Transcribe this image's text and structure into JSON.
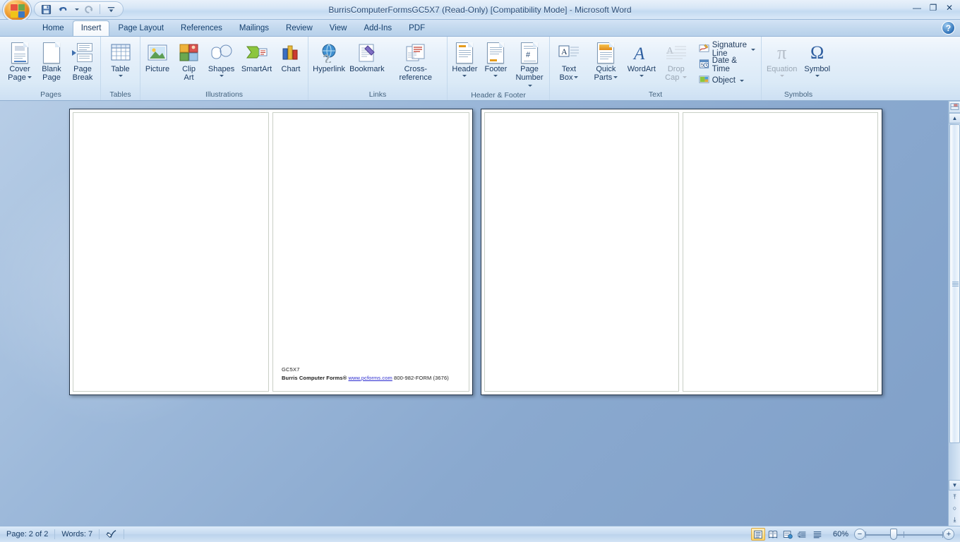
{
  "window": {
    "title": "BurrisComputerFormsGC5X7 (Read-Only) [Compatibility Mode] - Microsoft Word",
    "minimize": "—",
    "maximize": "❐",
    "close": "✕"
  },
  "quick_access": {
    "save": "save-icon",
    "undo": "undo-icon",
    "redo": "redo-icon",
    "customize": "customize-icon"
  },
  "tabs": [
    {
      "label": "Home",
      "active": false
    },
    {
      "label": "Insert",
      "active": true
    },
    {
      "label": "Page Layout",
      "active": false
    },
    {
      "label": "References",
      "active": false
    },
    {
      "label": "Mailings",
      "active": false
    },
    {
      "label": "Review",
      "active": false
    },
    {
      "label": "View",
      "active": false
    },
    {
      "label": "Add-Ins",
      "active": false
    },
    {
      "label": "PDF",
      "active": false
    }
  ],
  "help_button": "?",
  "ribbon": {
    "groups": [
      {
        "name": "Pages",
        "label": "Pages",
        "buttons": [
          {
            "label": "Cover Page",
            "dropdown": true,
            "disabled": false
          },
          {
            "label": "Blank Page",
            "dropdown": false,
            "disabled": false
          },
          {
            "label": "Page Break",
            "dropdown": false,
            "disabled": false
          }
        ]
      },
      {
        "name": "Tables",
        "label": "Tables",
        "buttons": [
          {
            "label": "Table",
            "dropdown": true,
            "disabled": false
          }
        ]
      },
      {
        "name": "Illustrations",
        "label": "Illustrations",
        "buttons": [
          {
            "label": "Picture",
            "dropdown": false,
            "disabled": false
          },
          {
            "label": "Clip Art",
            "dropdown": false,
            "disabled": false
          },
          {
            "label": "Shapes",
            "dropdown": true,
            "disabled": false
          },
          {
            "label": "SmartArt",
            "dropdown": false,
            "disabled": false
          },
          {
            "label": "Chart",
            "dropdown": false,
            "disabled": false
          }
        ]
      },
      {
        "name": "Links",
        "label": "Links",
        "buttons": [
          {
            "label": "Hyperlink",
            "dropdown": false,
            "disabled": false
          },
          {
            "label": "Bookmark",
            "dropdown": false,
            "disabled": false
          },
          {
            "label": "Cross-reference",
            "dropdown": false,
            "disabled": false
          }
        ]
      },
      {
        "name": "Header & Footer",
        "label": "Header & Footer",
        "buttons": [
          {
            "label": "Header",
            "dropdown": true,
            "disabled": false
          },
          {
            "label": "Footer",
            "dropdown": true,
            "disabled": false
          },
          {
            "label": "Page Number",
            "dropdown": true,
            "disabled": false
          }
        ]
      },
      {
        "name": "Text",
        "label": "Text",
        "buttons": [
          {
            "label": "Text Box",
            "dropdown": true,
            "disabled": false
          },
          {
            "label": "Quick Parts",
            "dropdown": true,
            "disabled": false
          },
          {
            "label": "WordArt",
            "dropdown": true,
            "disabled": false
          },
          {
            "label": "Drop Cap",
            "dropdown": true,
            "disabled": true
          }
        ],
        "small_buttons": [
          {
            "label": "Signature Line",
            "dropdown": true
          },
          {
            "label": "Date & Time",
            "dropdown": false
          },
          {
            "label": "Object",
            "dropdown": true
          }
        ]
      },
      {
        "name": "Symbols",
        "label": "Symbols",
        "buttons": [
          {
            "label": "Equation",
            "dropdown": true,
            "disabled": true,
            "glyph": "π"
          },
          {
            "label": "Symbol",
            "dropdown": true,
            "disabled": false,
            "glyph": "Ω"
          }
        ]
      }
    ]
  },
  "document": {
    "footer_code": "GC5X7",
    "footer_company": "Burris Computer Forms®",
    "footer_link": "www.pcforms.com",
    "footer_phone": "800-982-FORM (3676)"
  },
  "status": {
    "page": "Page: 2 of 2",
    "words": "Words: 7",
    "proof_icon": "proofing-icon",
    "zoom": "60%",
    "zoom_out": "−",
    "zoom_in": "+",
    "views": [
      {
        "name": "print-layout",
        "active": true
      },
      {
        "name": "full-screen-reading",
        "active": false
      },
      {
        "name": "web-layout",
        "active": false
      },
      {
        "name": "outline",
        "active": false
      },
      {
        "name": "draft",
        "active": false
      }
    ]
  },
  "scrollbar": {
    "split_handle": "split-handle",
    "up_arrow": "▲",
    "down_arrow": "▼",
    "prev_page": "⤒",
    "select_object": "○",
    "next_page": "⤓"
  },
  "colors": {
    "accent": "#1e395b",
    "link": "#2b2bd0",
    "desktop": "#8aa9cf"
  }
}
